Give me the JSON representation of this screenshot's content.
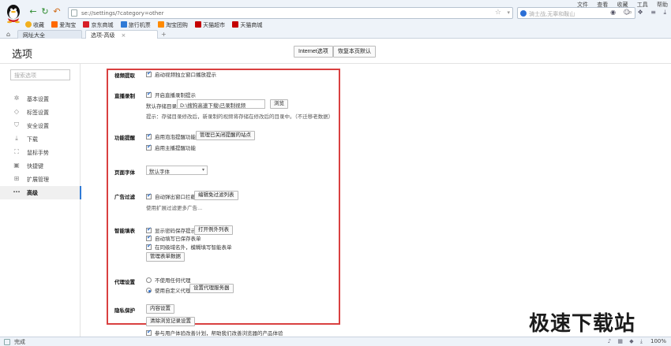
{
  "browser": {
    "url": "se://settings/?category=other",
    "search_placeholder": "骑士战,无辜和鞍山",
    "top_menu": [
      "文件",
      "查看",
      "收藏",
      "工具",
      "帮助"
    ],
    "bookmarks": [
      {
        "label": "收藏",
        "icon": "star-icon",
        "color": "#f2b01e"
      },
      {
        "label": "爱淘宝",
        "icon": "taobao-icon",
        "color": "#ff6a00"
      },
      {
        "label": "京东商城",
        "icon": "jd-icon",
        "color": "#d71f26"
      },
      {
        "label": "旅行机票",
        "icon": "travel-icon",
        "color": "#2f7ad6"
      },
      {
        "label": "淘宝团购",
        "icon": "tuan-icon",
        "color": "#ff8a00"
      },
      {
        "label": "天猫超市",
        "icon": "tmall-icon",
        "color": "#c40000"
      },
      {
        "label": "天猫商城",
        "icon": "tmall-icon",
        "color": "#c40000"
      }
    ],
    "tabs": [
      {
        "label": "网址大全",
        "active": false
      },
      {
        "label": "选项-高级",
        "active": true
      }
    ]
  },
  "header": {
    "title": "选项",
    "internet_options": "Internet选项",
    "restore_defaults": "恢复本页默认"
  },
  "sidebar": {
    "search_placeholder": "搜索选项",
    "items": [
      {
        "label": "基本设置",
        "icon": "gear-icon",
        "glyph": "✲"
      },
      {
        "label": "标签设置",
        "icon": "tag-icon",
        "glyph": "◇"
      },
      {
        "label": "安全设置",
        "icon": "shield-icon",
        "glyph": "⛉"
      },
      {
        "label": "下载",
        "icon": "download-icon",
        "glyph": "⤓"
      },
      {
        "label": "鼠标手势",
        "icon": "mouse-icon",
        "glyph": "⛶"
      },
      {
        "label": "快捷键",
        "icon": "keyboard-icon",
        "glyph": "▣"
      },
      {
        "label": "扩展管理",
        "icon": "extension-icon",
        "glyph": "⊞"
      },
      {
        "label": "高级",
        "icon": "more-icon",
        "glyph": "···",
        "active": true
      }
    ]
  },
  "settings": {
    "video": {
      "label": "视频提取",
      "opt_popup": "启动视频独立窗口播放提示"
    },
    "live": {
      "label": "直播录制",
      "opt_record": "开启直播录制提示",
      "path_label": "默认存储目录",
      "path_value": "D:\\搜狗高速下载\\已录制视频",
      "browse": "浏览",
      "hint": "提示：存储目录修改后，新录制的视频将存储在修改后的目录中。（不迁移老数据）"
    },
    "feature": {
      "label": "功能提醒",
      "opt_bubble": "启用泡泡提醒功能",
      "manage_closed": "管理已关闭提醒的站点",
      "opt_host": "启用主播提醒功能"
    },
    "font": {
      "label": "页面字体",
      "select_value": "默认字体"
    },
    "adblock": {
      "label": "广告过滤",
      "opt_popup_block": "自动弹出窗口拦截",
      "edit_list": "编辑免过滤列表",
      "hint": "使用扩展过滤更多广告..."
    },
    "smart_fill": {
      "label": "智能填表",
      "opt_save_prompt": "显示密码保存提示",
      "open_exceptions": "打开例外列表",
      "opt_autofill": "自动填写已保存表单",
      "opt_domain": "在同级域名外，模糊填写智能表单",
      "manage_data": "管理表单数据"
    },
    "proxy": {
      "label": "代理设置",
      "opt_none": "不使用任何代理",
      "opt_custom": "使用自定义代理",
      "set_servers": "设置代理服务器"
    },
    "privacy": {
      "label": "隐私保护",
      "content_settings": "内容设置",
      "clear_history": "清除浏览记录设置",
      "opt_ux": "参与用户体验改善计划，帮助我们改善浏览器的产品体验"
    }
  },
  "status": {
    "text": "完成",
    "zoom": "100%"
  },
  "watermark": "极速下载站"
}
